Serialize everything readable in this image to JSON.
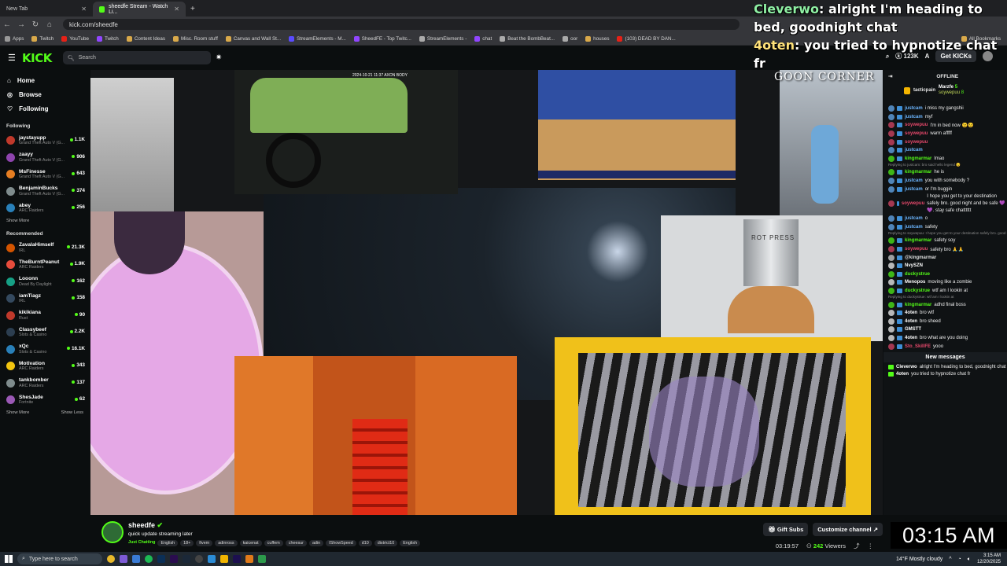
{
  "browser": {
    "tabs": [
      {
        "label": "New Tab",
        "active": false
      },
      {
        "label": "sheedfe Stream - Watch Li...",
        "active": true
      }
    ],
    "url": "kick.com/sheedfe",
    "bookmarks": [
      "Apps",
      "Twitch",
      "YouTube",
      "Twitch",
      "Content Ideas",
      "Misc. Room stuff",
      "Canvas and Wall St...",
      "StreamElements - M...",
      "SheedFE - Top Twitc...",
      "StreamElements -",
      "chat",
      "Beat the BombBeat...",
      "oor",
      "houses",
      "(103) DEAD BY DAN..."
    ],
    "all_bookmarks": "All Bookmarks"
  },
  "header": {
    "logo": "KICK",
    "search_placeholder": "Search",
    "kicks_count": "123K",
    "get_kicks": "Get KICKs"
  },
  "sidebar": {
    "nav": [
      {
        "label": "Home",
        "icon": "home-icon"
      },
      {
        "label": "Browse",
        "icon": "compass-icon"
      },
      {
        "label": "Following",
        "icon": "heart-icon"
      }
    ],
    "following_title": "Following",
    "following": [
      {
        "name": "jaystayupp",
        "game": "Grand Theft Auto V (G...",
        "viewers": "1.1K",
        "color": "#c0392b"
      },
      {
        "name": "zaayy",
        "game": "Grand Theft Auto V (G...",
        "viewers": "906",
        "color": "#8e44ad"
      },
      {
        "name": "MsFinesse",
        "game": "Grand Theft Auto V (G...",
        "viewers": "643",
        "color": "#e67e22"
      },
      {
        "name": "BenjaminBucks",
        "game": "Grand Theft Auto V (G...",
        "viewers": "374",
        "color": "#7f8c8d"
      },
      {
        "name": "abey",
        "game": "ARC Raiders",
        "viewers": "256",
        "color": "#2980b9"
      }
    ],
    "show_more": "Show More",
    "recommended_title": "Recommended",
    "recommended": [
      {
        "name": "ZavalaHimself",
        "game": "IRL",
        "viewers": "21.3K",
        "color": "#d35400"
      },
      {
        "name": "TheBurntPeanut",
        "game": "ARC Raiders",
        "viewers": "1.9K",
        "color": "#e74c3c"
      },
      {
        "name": "Looonn",
        "game": "Dead By Daylight",
        "viewers": "162",
        "color": "#16a085"
      },
      {
        "name": "iamTiagz",
        "game": "IRL",
        "viewers": "158",
        "color": "#34495e"
      },
      {
        "name": "kikikiana",
        "game": "Rust",
        "viewers": "90",
        "color": "#c0392b"
      },
      {
        "name": "Classybeef",
        "game": "Slots & Casino",
        "viewers": "2.2K",
        "color": "#2c3e50"
      },
      {
        "name": "xQc",
        "game": "Slots & Casino",
        "viewers": "16.1K",
        "color": "#2980b9"
      },
      {
        "name": "Motivation",
        "game": "ARC Raiders",
        "viewers": "343",
        "color": "#f1c40f"
      },
      {
        "name": "tankbomber",
        "game": "ARC Raiders",
        "viewers": "137",
        "color": "#7f8c8d"
      },
      {
        "name": "ShesJade",
        "game": "Fortnite",
        "viewers": "62",
        "color": "#9b59b6"
      }
    ],
    "show_less": "Show Less"
  },
  "video": {
    "overlay_messages": [
      {
        "user": "Cleverwo",
        "text": "alright I'm heading to bed, goodnight chat"
      },
      {
        "user": "4oten",
        "text": "you tried to hypnotize chat fr"
      }
    ],
    "goon_corner": "GOON CORNER",
    "dashcam_stamp": "2024-10-21 11:37 AXON BODY",
    "press_text": "ROT PRESS"
  },
  "chat": {
    "status": "OFFLINE",
    "pinned_user": "tacticpain",
    "pinned_tag1": "Marzfe",
    "pinned_tag2": "soywepuu",
    "pinned_count1": "5",
    "pinned_count2": "8",
    "messages": [
      {
        "type": "msg",
        "user": "justcam",
        "color": "#6cb6ff",
        "text": "i miss my gangshii"
      },
      {
        "type": "msg",
        "user": "justcam",
        "color": "#6cb6ff",
        "text": "myf"
      },
      {
        "type": "msg",
        "user": "soywepuu",
        "color": "#e5486b",
        "text": "I'm in bed now 😉😉"
      },
      {
        "type": "msg",
        "user": "soywepuu",
        "color": "#e5486b",
        "text": "warm afffff"
      },
      {
        "type": "msg",
        "user": "soywepuu",
        "color": "#e5486b",
        "text": ""
      },
      {
        "type": "msg",
        "user": "justcam",
        "color": "#6cb6ff",
        "text": ""
      },
      {
        "type": "msg",
        "user": "kingmarmar",
        "color": "#53fc18",
        "text": "lmao"
      },
      {
        "type": "reply",
        "text": "Replying to justcam: bro said hello legend 😏"
      },
      {
        "type": "msg",
        "user": "kingmarmar",
        "color": "#53fc18",
        "text": "he is"
      },
      {
        "type": "msg",
        "user": "justcam",
        "color": "#6cb6ff",
        "text": "you with somebody ?"
      },
      {
        "type": "msg",
        "user": "justcam",
        "color": "#6cb6ff",
        "text": "or I'm buggin"
      },
      {
        "type": "msg2",
        "user": "soywepuu",
        "color": "#e5486b",
        "text": "I hope you get to your destination safely bro. good night and be safe 💜💜. stay safe chatttttt"
      },
      {
        "type": "msg",
        "user": "justcam",
        "color": "#6cb6ff",
        "text": "o"
      },
      {
        "type": "msg",
        "user": "justcam",
        "color": "#6cb6ff",
        "text": "safety"
      },
      {
        "type": "reply",
        "text": "Replying to soywepuu: I hope you get to your destination safely bro. good night and be safe 💜💜. stay safe chatttttt"
      },
      {
        "type": "msg",
        "user": "kingmarmar",
        "color": "#53fc18",
        "text": "safety soy"
      },
      {
        "type": "msg",
        "user": "soywepuu",
        "color": "#e5486b",
        "text": "safety bro 🙏🙏"
      },
      {
        "type": "msg",
        "user": "@kingmarmar",
        "color": "#dddddd",
        "text": ""
      },
      {
        "type": "msg",
        "user": "NvySZN",
        "color": "#ffffff",
        "text": ""
      },
      {
        "type": "msg",
        "user": "duckystrue",
        "color": "#53fc18",
        "text": ""
      },
      {
        "type": "msg",
        "user": "Menopos",
        "color": "#ffffff",
        "text": "moving like a zombie"
      },
      {
        "type": "msg",
        "user": "duckystrue",
        "color": "#53fc18",
        "text": "wtf am I lookin at"
      },
      {
        "type": "reply",
        "text": "Replying to duckystrue: wtf am I lookin at"
      },
      {
        "type": "msg",
        "user": "kingmarmar",
        "color": "#53fc18",
        "text": "adhd final boss"
      },
      {
        "type": "msg",
        "user": "4oten",
        "color": "#ffffff",
        "text": "bro wtf"
      },
      {
        "type": "msg",
        "user": "4oten",
        "color": "#ffffff",
        "text": "bro sheed"
      },
      {
        "type": "msg",
        "user": "GMSTT",
        "color": "#ffffff",
        "text": ""
      },
      {
        "type": "msg",
        "user": "4oten",
        "color": "#ffffff",
        "text": "bro what are you doing"
      },
      {
        "type": "msg",
        "user": "Sto_SkillFE",
        "color": "#e5486b",
        "text": "yooo"
      }
    ],
    "new_messages_label": "New messages",
    "after": [
      {
        "user": "Cleverwo",
        "color": "#ffffff",
        "text": "alright I'm heading to bed, goodnight chat"
      },
      {
        "user": "4oten",
        "color": "#ffffff",
        "text": "you tried to hypnotize chat fr"
      }
    ]
  },
  "stream_info": {
    "streamer": "sheedfe",
    "title": "quick update streaming later",
    "category": "Just Chatting",
    "tags": [
      "English",
      "18+",
      "fivem",
      "adinross",
      "kaicenat",
      "cuffem",
      "cheesur",
      "adin",
      "IShowSpeed",
      "d10",
      "district10",
      "English"
    ],
    "gift_subs": "Gift Subs",
    "customize": "Customize channel",
    "uptime": "03:19:57",
    "viewers_count": "242",
    "viewers_label": "Viewers"
  },
  "overlay_clock": "03:15 AM",
  "taskbar": {
    "search_placeholder": "Type here to search",
    "weather": "14°F  Mostly cloudy",
    "time": "3:15 AM",
    "date": "12/20/2025"
  }
}
